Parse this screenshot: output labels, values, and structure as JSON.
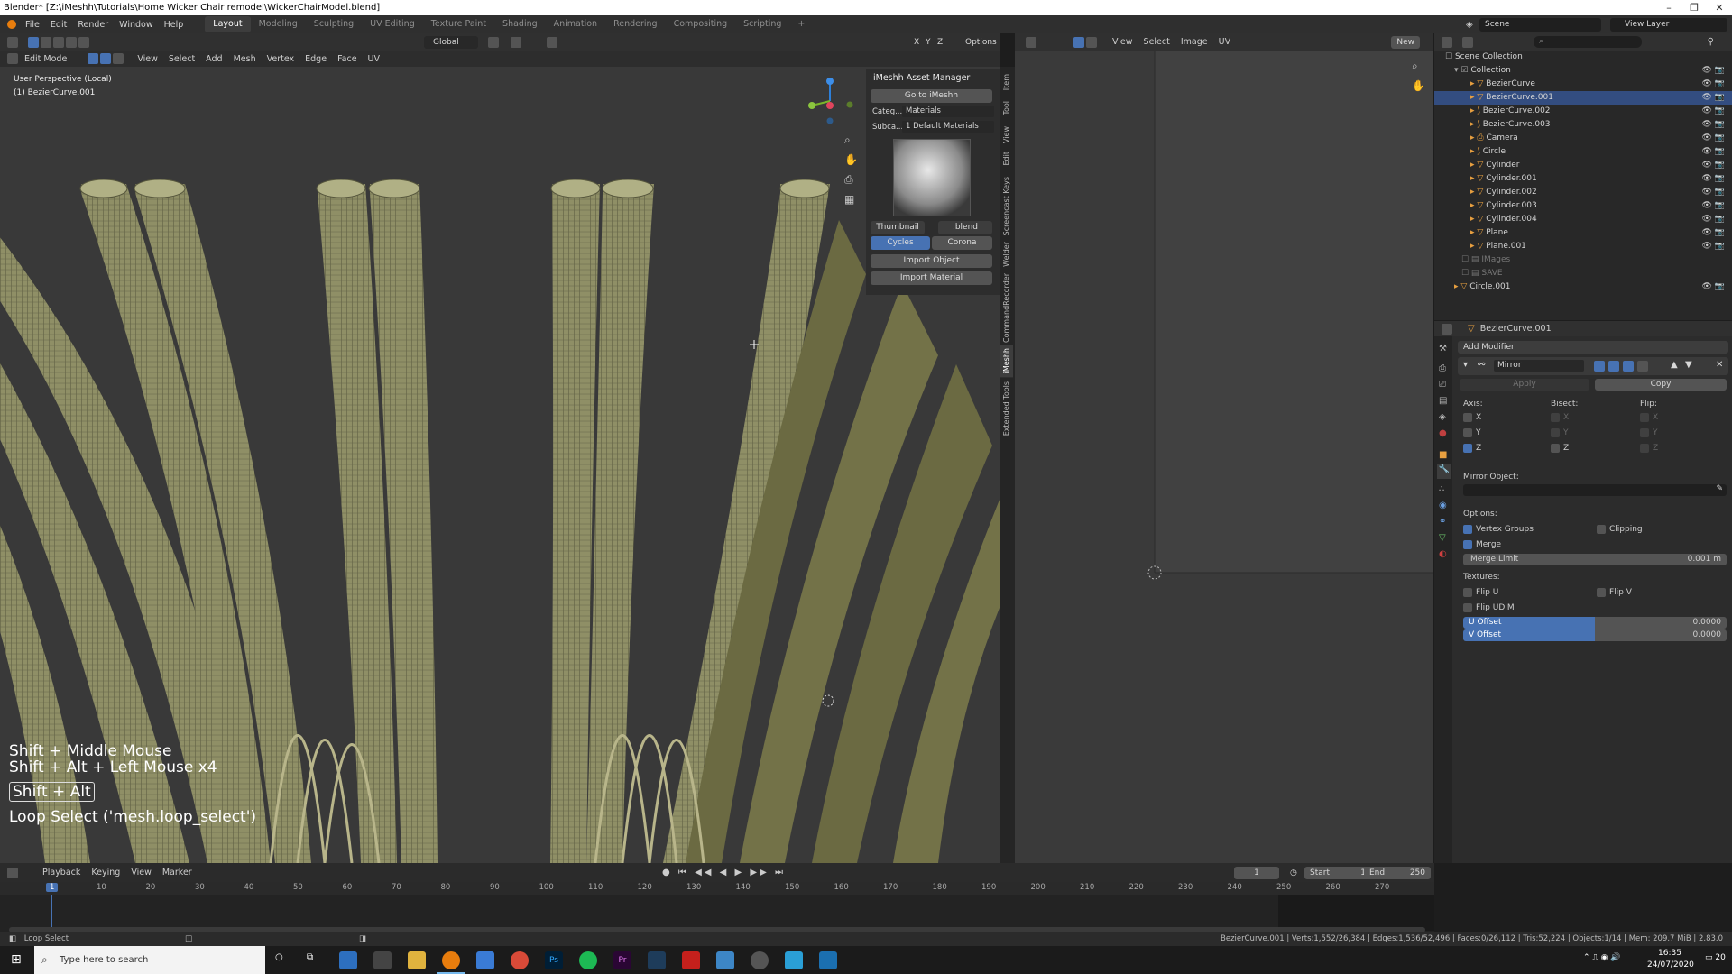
{
  "window": {
    "title": "Blender* [Z:\\iMeshh\\Tutorials\\Home Wicker Chair remodel\\WickerChairModel.blend]"
  },
  "menu": [
    "File",
    "Edit",
    "Render",
    "Window",
    "Help"
  ],
  "workspaces": [
    "Layout",
    "Modeling",
    "Sculpting",
    "UV Editing",
    "Texture Paint",
    "Shading",
    "Animation",
    "Rendering",
    "Compositing",
    "Scripting"
  ],
  "scene": {
    "label": "Scene",
    "view_layer": "View Layer"
  },
  "viewport": {
    "mode": "Edit Mode",
    "menus": [
      "View",
      "Select",
      "Add",
      "Mesh",
      "Vertex",
      "Edge",
      "Face",
      "UV"
    ],
    "transform": "Global",
    "axes": [
      "X",
      "Y",
      "Z"
    ],
    "options": "Options",
    "perspective": "User Perspective (Local)",
    "object": "(1) BezierCurve.001",
    "keys": [
      "Shift + Middle Mouse",
      "Shift + Alt + Left Mouse x4"
    ],
    "key_box": "Shift + Alt",
    "operator": "Loop Select ('mesh.loop_select')"
  },
  "asset_manager": {
    "title": "iMeshh Asset Manager",
    "goto": "Go to iMeshh",
    "cat_label": "Categ...",
    "cat_value": "Materials",
    "sub_label": "Subca...",
    "sub_value": "1 Default Materials",
    "thumb": "Thumbnail",
    "blend": ".blend",
    "engines": [
      "Cycles",
      "Corona"
    ],
    "import_object": "Import Object",
    "import_material": "Import Material"
  },
  "sidetabs": [
    "Item",
    "Tool",
    "View",
    "Edit",
    "Screencast Keys",
    "Welder",
    "CommandRecorder",
    "iMeshh",
    "Extended Tools"
  ],
  "uv_editor": {
    "menus": [
      "View",
      "Select",
      "Image",
      "UV"
    ],
    "new": "New"
  },
  "outliner": {
    "root": "Scene Collection",
    "collection": "Collection",
    "items": [
      "BezierCurve",
      "BezierCurve.001",
      "BezierCurve.002",
      "BezierCurve.003",
      "Camera",
      "Circle",
      "Cylinder",
      "Cylinder.001",
      "Cylinder.002",
      "Cylinder.003",
      "Cylinder.004",
      "Plane",
      "Plane.001",
      "IMages",
      "SAVE",
      "Circle.001"
    ],
    "selected": "BezierCurve.001"
  },
  "properties": {
    "object": "BezierCurve.001",
    "add_modifier": "Add Modifier",
    "modifier": "Mirror",
    "apply": "Apply",
    "copy": "Copy",
    "axis": "Axis:",
    "bisect": "Bisect:",
    "flip": "Flip:",
    "axes": [
      "X",
      "Y",
      "Z"
    ],
    "mirror_object": "Mirror Object:",
    "options": "Options:",
    "vertex_groups": "Vertex Groups",
    "clipping": "Clipping",
    "merge": "Merge",
    "merge_limit": "Merge Limit",
    "merge_limit_value": "0.001 m",
    "textures": "Textures:",
    "flip_u": "Flip U",
    "flip_v": "Flip V",
    "flip_udim": "Flip UDIM",
    "u_offset": "U Offset",
    "u_offset_value": "0.0000",
    "v_offset": "V Offset",
    "v_offset_value": "0.0000"
  },
  "timeline": {
    "menus": [
      "Playback",
      "Keying",
      "View",
      "Marker"
    ],
    "current": "1",
    "start_label": "Start",
    "start": "1",
    "end_label": "End",
    "end": "250",
    "ticks": [
      "1",
      "10",
      "20",
      "30",
      "40",
      "50",
      "60",
      "70",
      "80",
      "90",
      "100",
      "110",
      "120",
      "130",
      "140",
      "150",
      "160",
      "170",
      "180",
      "190",
      "200",
      "210",
      "220",
      "230",
      "240",
      "250",
      "260",
      "270"
    ]
  },
  "status": {
    "left": "Loop Select",
    "right": "BezierCurve.001 | Verts:1,552/26,384 | Edges:1,536/52,496 | Faces:0/26,112 | Tris:52,224 | Objects:1/14 | Mem: 209.7 MiB | 2.83.0"
  },
  "taskbar": {
    "search": "Type here to search",
    "time": "16:35",
    "date": "24/07/2020",
    "notif": "20"
  },
  "colors": {
    "accent": "#4772b3",
    "selected_row": "#334d80",
    "tube": "#8f8f66",
    "tube_dark": "#63613f"
  }
}
